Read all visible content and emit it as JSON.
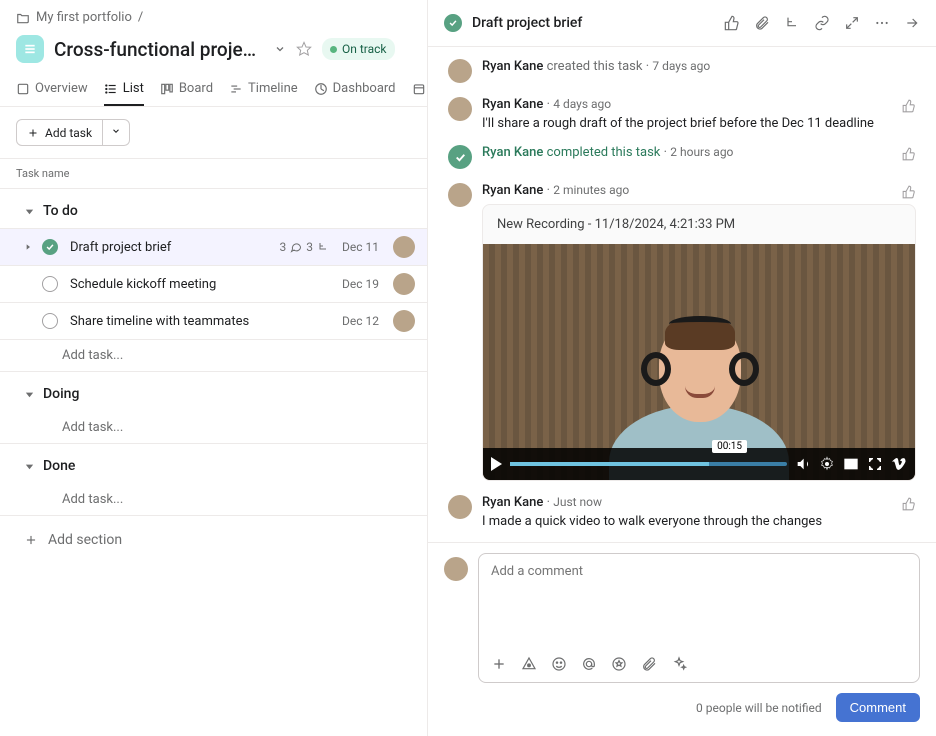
{
  "breadcrumb": {
    "portfolio": "My first portfolio",
    "sep": "/"
  },
  "project": {
    "title": "Cross-functional projec...",
    "status": "On track"
  },
  "tabs": {
    "overview": "Overview",
    "list": "List",
    "board": "Board",
    "timeline": "Timeline",
    "dashboard": "Dashboard",
    "calendar": "C"
  },
  "toolbar": {
    "add_task": "Add task"
  },
  "columns": {
    "task_name": "Task name"
  },
  "sections": {
    "todo": {
      "label": "To do",
      "add": "Add task..."
    },
    "doing": {
      "label": "Doing",
      "add": "Add task..."
    },
    "done": {
      "label": "Done",
      "add": "Add task..."
    }
  },
  "tasks": {
    "t1": {
      "name": "Draft project brief",
      "due": "Dec 11",
      "comments": "3",
      "subtasks": "3"
    },
    "t2": {
      "name": "Schedule kickoff meeting",
      "due": "Dec 19"
    },
    "t3": {
      "name": "Share timeline with teammates",
      "due": "Dec 12"
    }
  },
  "add_section": "Add section",
  "detail": {
    "title": "Draft project brief",
    "activity": {
      "a1": {
        "name": "Ryan Kane",
        "action": "created this task",
        "time": "7 days ago"
      },
      "a2": {
        "name": "Ryan Kane",
        "time": "4 days ago",
        "text": "I'll share a rough draft of the project brief before the Dec 11 deadline"
      },
      "a3": {
        "name": "Ryan Kane",
        "action": "completed this task",
        "time": "2 hours ago"
      },
      "a4": {
        "name": "Ryan Kane",
        "time": "2 minutes ago"
      },
      "a5": {
        "name": "Ryan Kane",
        "time": "Just now",
        "text": "I made a quick video to walk everyone through the changes"
      }
    },
    "video": {
      "title": "New Recording - 11/18/2024, 4:21:33 PM",
      "time": "00:15"
    },
    "comment_placeholder": "Add a comment",
    "notify": "0 people will be notified",
    "comment_btn": "Comment"
  }
}
